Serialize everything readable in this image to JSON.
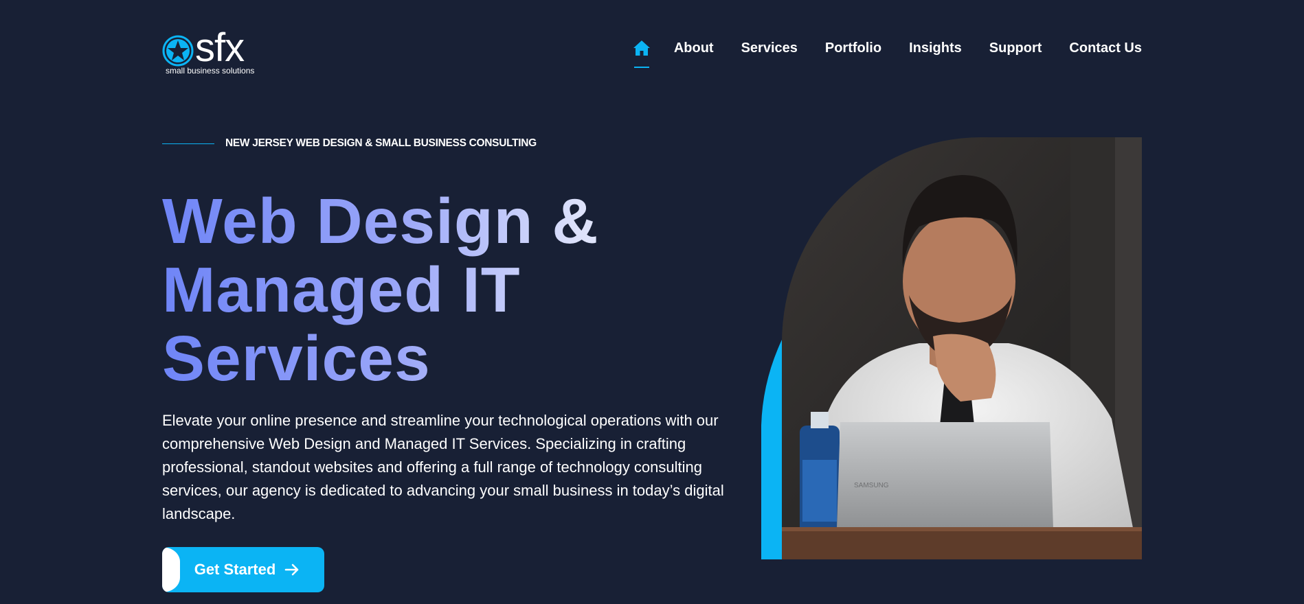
{
  "brand": {
    "logo_text": "sfx",
    "tagline": "small business solutions",
    "accent_color": "#0bb4f4",
    "background_color": "#182035"
  },
  "nav": {
    "home_icon": "home-icon",
    "items": [
      {
        "label": "About"
      },
      {
        "label": "Services"
      },
      {
        "label": "Portfolio"
      },
      {
        "label": "Insights"
      },
      {
        "label": "Support"
      },
      {
        "label": "Contact Us"
      }
    ]
  },
  "hero": {
    "eyebrow": "NEW JERSEY WEB DESIGN & SMALL BUSINESS CONSULTING",
    "title_lines": [
      "Web Design &",
      "Managed IT",
      "Services"
    ],
    "description": "Elevate your online presence and streamline your technological operations with our comprehensive Web Design and Managed IT Services. Specializing in crafting professional, standout websites and offering a full range of technology consulting services, our agency is dedicated to advancing your small business in today’s digital landscape.",
    "cta_label": "Get Started",
    "cta_icon": "arrow-right-icon",
    "image_subject": "man in white shirt and tie working on a laptop",
    "laptop_brand": "SAMSUNG"
  }
}
